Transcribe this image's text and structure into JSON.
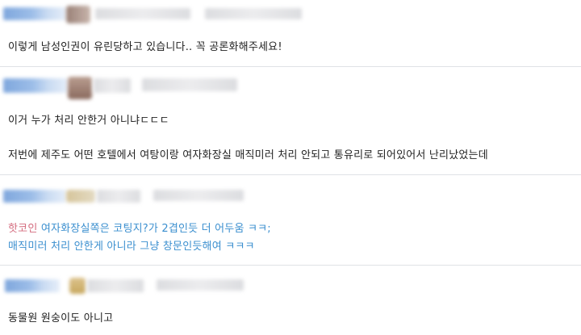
{
  "comments": [
    {
      "lines": [
        "이렇게 남성인권이 유린당하고 있습니다.. 꼭 공론화해주세요!"
      ]
    },
    {
      "lines": [
        "이거 누가 처리 안한거 아니냐ㄷㄷㄷ",
        "저번에 제주도 어떤 호텔에서 여탕이랑 여자화장실 매직미러 처리 안되고 통유리로 되어있어서 난리났었는데"
      ]
    },
    {
      "reply": {
        "author": "핫코인",
        "line1": "여자화장실쪽은 코팅지?가 2겹인듯 더 어두움 ㅋㅋ;",
        "line2": "매직미러 처리 안한게 아니라 그냥 창문인듯해여 ㅋㅋㅋ"
      }
    },
    {
      "lines": [
        "동물원 원숭이도 아니고"
      ]
    }
  ],
  "colors": {
    "reply_author": "#d46b7e",
    "reply_text": "#3b8fcf",
    "divider": "#dfe2e6"
  }
}
